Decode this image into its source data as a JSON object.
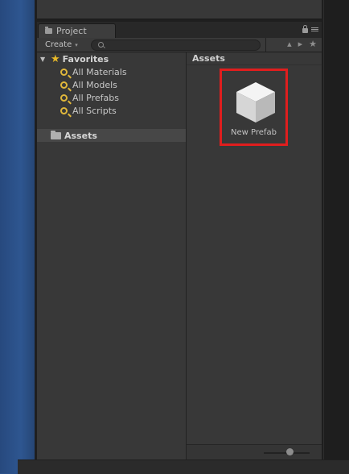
{
  "tab": {
    "label": "Project",
    "icon": "folder-icon"
  },
  "toolbar": {
    "create_label": "Create",
    "create_caret": "▾",
    "search": {
      "value": "",
      "placeholder": ""
    },
    "icons": [
      "filter-by-type-icon",
      "filter-by-label-icon",
      "favorite-star-icon"
    ]
  },
  "favorites": {
    "label": "Favorites",
    "items": [
      {
        "label": "All Materials"
      },
      {
        "label": "All Models"
      },
      {
        "label": "All Prefabs"
      },
      {
        "label": "All Scripts"
      }
    ]
  },
  "tree": {
    "assets_label": "Assets"
  },
  "assets_panel": {
    "header": "Assets",
    "items": [
      {
        "label": "New Prefab",
        "icon": "prefab-cube-icon",
        "highlight_color": "#e01e1e"
      }
    ]
  },
  "colors": {
    "panel_bg": "#383838",
    "selected_row": "#474747",
    "accent_star": "#e8b928",
    "highlight": "#e01e1e"
  }
}
